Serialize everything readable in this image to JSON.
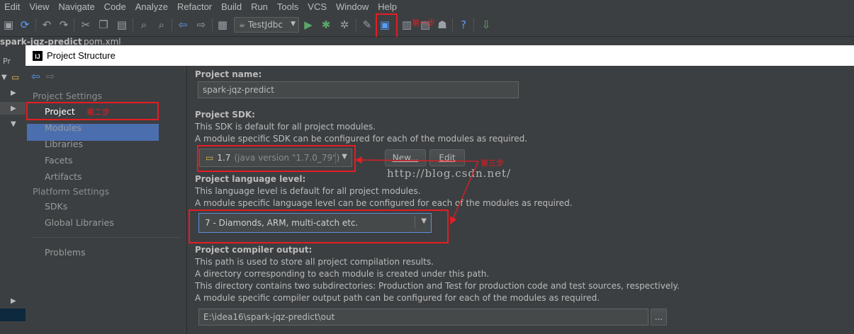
{
  "menu": [
    "Edit",
    "View",
    "Navigate",
    "Code",
    "Analyze",
    "Refactor",
    "Build",
    "Run",
    "Tools",
    "VCS",
    "Window",
    "Help"
  ],
  "toolbar": {
    "run_config": "TestJdbc",
    "icons": [
      "save-all-icon",
      "sync-icon",
      "undo-icon",
      "redo-icon",
      "cut-icon",
      "copy-icon",
      "paste-icon",
      "find-icon",
      "replace-icon",
      "back-icon",
      "forward-icon",
      "run-icon",
      "debug-icon",
      "coverage-icon",
      "settings-icon",
      "project-structure-icon",
      "sdk-manager-icon",
      "android-icon",
      "help-icon",
      "update-icon"
    ],
    "step1_note": "第一步"
  },
  "background": {
    "project_tab": "spark-jqz-predict",
    "file_tab": "pom.xml",
    "tool_label": "Pr"
  },
  "dialog": {
    "title": "Project Structure",
    "sidebar": {
      "project_settings_header": "Project Settings",
      "project_settings_items": [
        "Project",
        "Modules",
        "Libraries",
        "Facets",
        "Artifacts"
      ],
      "platform_settings_header": "Platform Settings",
      "platform_settings_items": [
        "SDKs",
        "Global Libraries"
      ],
      "problems": "Problems",
      "step2_note": "第二步"
    },
    "main": {
      "name_label": "Project name:",
      "name_value": "spark-jqz-predict",
      "sdk_label": "Project SDK:",
      "sdk_desc1": "This SDK is default for all project modules.",
      "sdk_desc2": "A module specific SDK can be configured for each of the modules as required.",
      "sdk_version": "1.7",
      "sdk_detail": "(java version \"1.7.0_79\")",
      "new_button": "New...",
      "edit_button": "Edit",
      "step3_note": "第三步",
      "watermark": "http://blog.csdn.net/",
      "lang_label": "Project language level:",
      "lang_desc1": "This language level is default for all project modules.",
      "lang_desc2": "A module specific language level can be configured for each of the modules as required.",
      "lang_value": "7 - Diamonds, ARM, multi-catch etc.",
      "output_label": "Project compiler output:",
      "output_desc1": "This path is used to store all project compilation results.",
      "output_desc2": "A directory corresponding to each module is created under this path.",
      "output_desc3": "This directory contains two subdirectories: Production and Test for production code and test sources, respectively.",
      "output_desc4": "A module specific compiler output path can be configured for each of the modules as required.",
      "output_path": "E:\\idea16\\spark-jqz-predict\\out",
      "browse_button": "..."
    }
  },
  "colors": {
    "annotation_red": "#e51c23",
    "selection_blue": "#4b6eaf",
    "panel_bg": "#3c3f41"
  }
}
